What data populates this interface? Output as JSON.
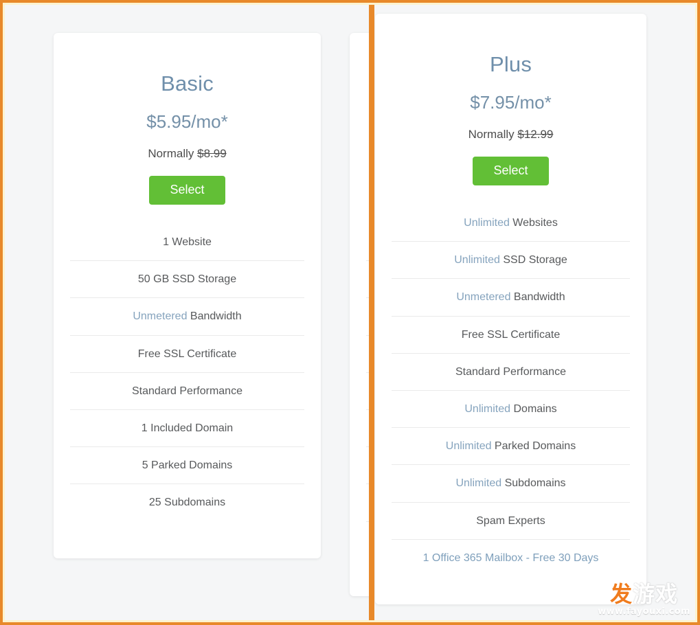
{
  "theme": {
    "frame_color": "#e8892a",
    "frame_inner_color": "#fdf3cf",
    "panel_background": "#f5f6f7",
    "card_background": "#ffffff",
    "accent_blue": "#6f8fab",
    "highlight_blue": "#85a3bd",
    "button_green": "#62bf36",
    "feature_text": "#57595b",
    "divider": "#eaeaea"
  },
  "plans": [
    {
      "id": "basic",
      "name": "Basic",
      "price": "$5.95/mo*",
      "normally_label": "Normally",
      "normally_price": "$8.99",
      "select_label": "Select",
      "features": [
        {
          "highlight": "",
          "text": "1 Website"
        },
        {
          "highlight": "",
          "text": "50 GB SSD Storage"
        },
        {
          "highlight": "Unmetered",
          "text": " Bandwidth"
        },
        {
          "highlight": "",
          "text": "Free SSL Certificate"
        },
        {
          "highlight": "",
          "text": "Standard Performance"
        },
        {
          "highlight": "",
          "text": "1 Included Domain"
        },
        {
          "highlight": "",
          "text": "5 Parked Domains"
        },
        {
          "highlight": "",
          "text": "25 Subdomains"
        }
      ]
    },
    {
      "id": "plus",
      "name": "Plus",
      "price": "$7.95/mo*",
      "normally_label": "Normally",
      "normally_price": "$12.99",
      "select_label": "Select",
      "features": [
        {
          "highlight": "Unlimited",
          "text": " Websites"
        },
        {
          "highlight": "Unlimited",
          "text": " SSD Storage"
        },
        {
          "highlight": "Unmetered",
          "text": " Bandwidth"
        },
        {
          "highlight": "",
          "text": "Free SSL Certificate"
        },
        {
          "highlight": "",
          "text": "Standard Performance"
        },
        {
          "highlight": "Unlimited",
          "text": " Domains"
        },
        {
          "highlight": "Unlimited",
          "text": " Parked Domains"
        },
        {
          "highlight": "Unlimited",
          "text": " Subdomains"
        },
        {
          "highlight": "",
          "text": "Spam Experts"
        },
        {
          "highlight": "",
          "text": "1 Office 365 Mailbox - Free 30 Days",
          "all_highlight": true
        }
      ]
    }
  ],
  "watermark": {
    "char_1": "发",
    "char_2": "游戏",
    "url": "www.fayouxi.com"
  }
}
